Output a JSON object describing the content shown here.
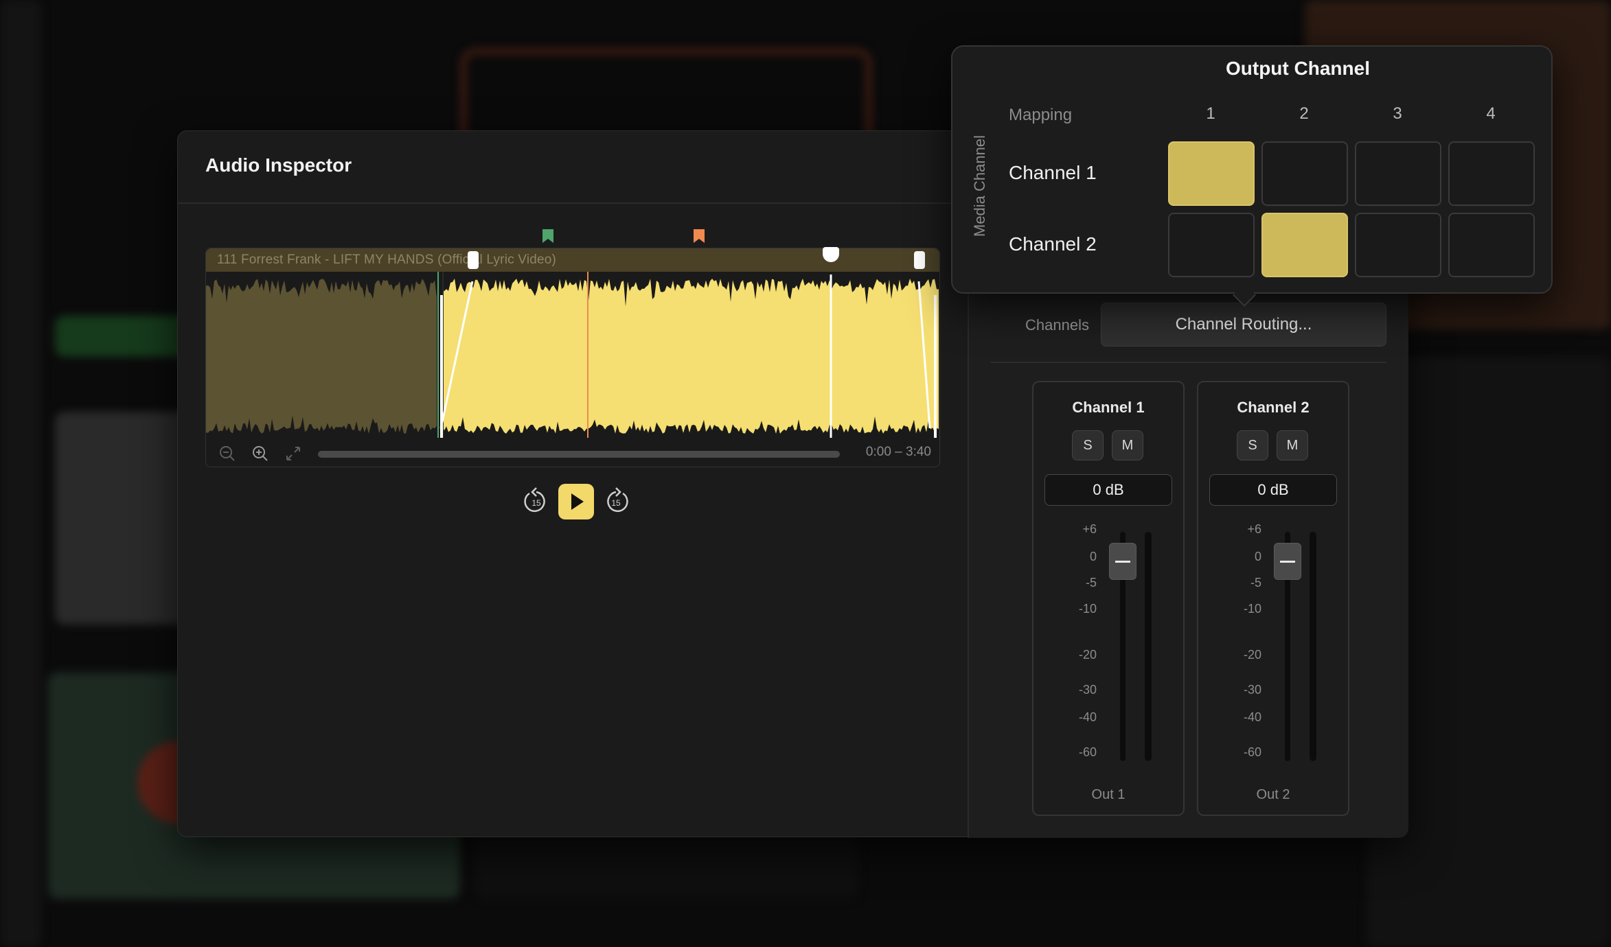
{
  "inspector": {
    "title": "Audio Inspector"
  },
  "waveform": {
    "track_title": "111 Forrest Frank - LIFT MY HANDS (Official Lyric Video)",
    "time_range": "0:00 – 3:40",
    "marker_colors": [
      "#4fa56c",
      "#f08a4f"
    ],
    "wave_color": "#f5df72",
    "dim_wave_color": "#5c5333"
  },
  "transport": {
    "skip_back_seconds": "15",
    "skip_forward_seconds": "15"
  },
  "routing": {
    "title": "Output Channel",
    "mapping_label": "Mapping",
    "axis_label": "Media Channel",
    "columns": [
      "1",
      "2",
      "3",
      "4"
    ],
    "rows": [
      {
        "label": "Channel 1",
        "active_output": "1"
      },
      {
        "label": "Channel 2",
        "active_output": "2"
      }
    ],
    "accent_color": "#cdb85a"
  },
  "channels_section": {
    "label": "Channels",
    "button_label": "Channel Routing..."
  },
  "mixer": {
    "scale": [
      "+6",
      "0",
      "-5",
      "-10",
      "-20",
      "-30",
      "-40",
      "-60"
    ],
    "strips": [
      {
        "name": "Channel 1",
        "solo": "S",
        "mute": "M",
        "gain": "0 dB",
        "output": "Out 1"
      },
      {
        "name": "Channel 2",
        "solo": "S",
        "mute": "M",
        "gain": "0 dB",
        "output": "Out 2"
      }
    ]
  }
}
